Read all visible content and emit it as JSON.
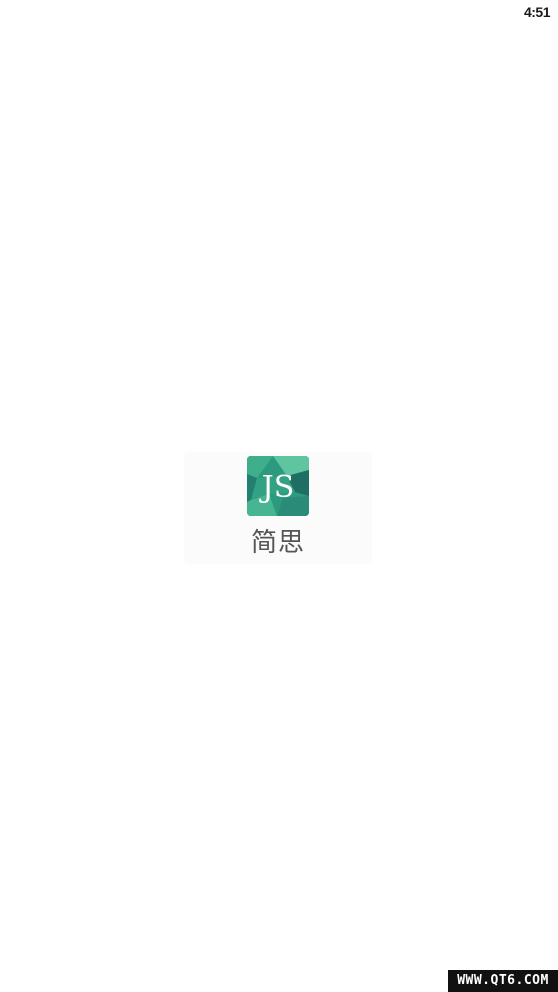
{
  "status_bar": {
    "time": "4:51"
  },
  "splash": {
    "app_icon": {
      "name": "js-logo-icon",
      "letters": "JS",
      "colors": {
        "base": "#2c9a7e",
        "light": "#5fc4a0",
        "dark": "#1e6e63",
        "letters": "#ffffff"
      }
    },
    "app_name": "简思"
  },
  "watermark": {
    "text": "WWW.QT6.COM"
  }
}
